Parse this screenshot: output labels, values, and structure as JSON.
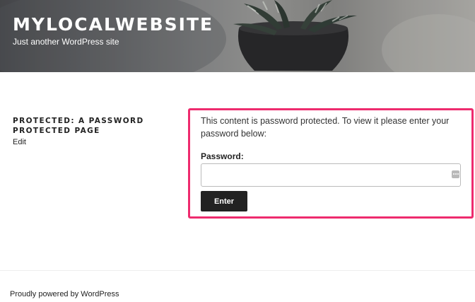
{
  "site": {
    "title": "MYLOCALWEBSITE",
    "tagline": "Just another WordPress site"
  },
  "entry": {
    "title": "PROTECTED: A PASSWORD PROTECTED PAGE",
    "edit_label": "Edit"
  },
  "password_form": {
    "message": "This content is password protected. To view it please enter your password below:",
    "label": "Password:",
    "input_value": "",
    "submit_label": "Enter"
  },
  "footer": {
    "credit": "Proudly powered by WordPress"
  },
  "colors": {
    "highlight": "#ee2b6e",
    "button": "#222222"
  }
}
